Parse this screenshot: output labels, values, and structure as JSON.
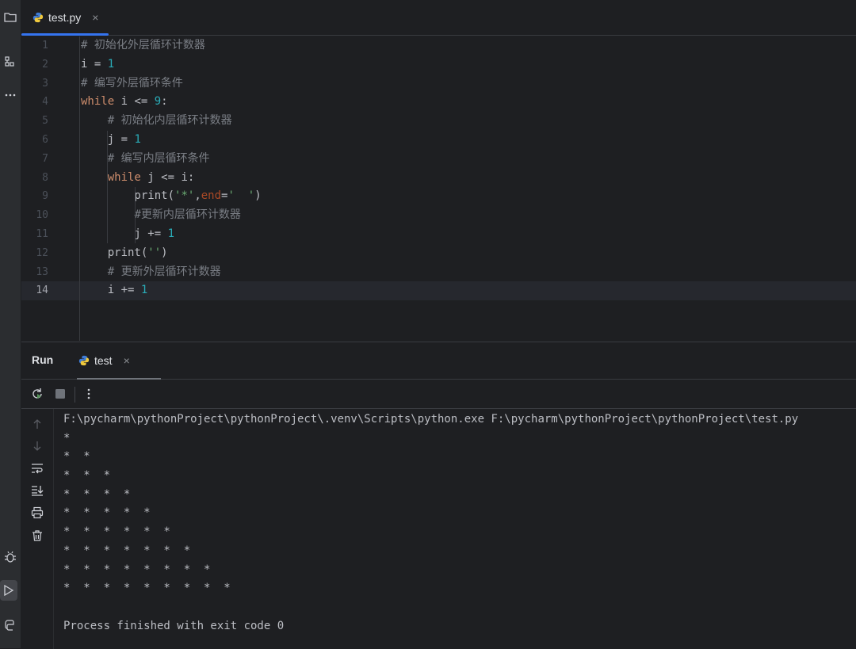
{
  "editor": {
    "tab": {
      "label": "test.py",
      "close": "×",
      "icon": "python-file-icon"
    },
    "current_line": 14,
    "lines": [
      {
        "n": "1",
        "tokens": [
          {
            "c": "cm",
            "t": "# 初始化外层循环计数器"
          }
        ]
      },
      {
        "n": "2",
        "tokens": [
          {
            "c": "",
            "t": "i = "
          },
          {
            "c": "num",
            "t": "1"
          }
        ]
      },
      {
        "n": "3",
        "tokens": [
          {
            "c": "cm",
            "t": "# 编写外层循环条件"
          }
        ]
      },
      {
        "n": "4",
        "tokens": [
          {
            "c": "kw",
            "t": "while"
          },
          {
            "c": "",
            "t": " i <= "
          },
          {
            "c": "num",
            "t": "9"
          },
          {
            "c": "",
            "t": ":"
          }
        ]
      },
      {
        "n": "5",
        "tokens": [
          {
            "c": "",
            "t": "    "
          },
          {
            "c": "cm",
            "t": "# 初始化内层循环计数器"
          }
        ]
      },
      {
        "n": "6",
        "tokens": [
          {
            "c": "",
            "t": "    j = "
          },
          {
            "c": "num",
            "t": "1"
          }
        ]
      },
      {
        "n": "7",
        "tokens": [
          {
            "c": "",
            "t": "    "
          },
          {
            "c": "cm",
            "t": "# 编写内层循环条件"
          }
        ]
      },
      {
        "n": "8",
        "tokens": [
          {
            "c": "",
            "t": "    "
          },
          {
            "c": "kw",
            "t": "while"
          },
          {
            "c": "",
            "t": " j <= i:"
          }
        ]
      },
      {
        "n": "9",
        "tokens": [
          {
            "c": "",
            "t": "        print("
          },
          {
            "c": "str",
            "t": "'*'"
          },
          {
            "c": "",
            "t": ","
          },
          {
            "c": "kwarg",
            "t": "end"
          },
          {
            "c": "",
            "t": "="
          },
          {
            "c": "str",
            "t": "'  '"
          },
          {
            "c": "",
            "t": ")"
          }
        ]
      },
      {
        "n": "10",
        "tokens": [
          {
            "c": "",
            "t": "        "
          },
          {
            "c": "cm",
            "t": "#更新内层循环计数器"
          }
        ]
      },
      {
        "n": "11",
        "tokens": [
          {
            "c": "",
            "t": "        j += "
          },
          {
            "c": "num",
            "t": "1"
          }
        ]
      },
      {
        "n": "12",
        "tokens": [
          {
            "c": "",
            "t": "    print("
          },
          {
            "c": "str",
            "t": "''"
          },
          {
            "c": "",
            "t": ")"
          }
        ]
      },
      {
        "n": "13",
        "tokens": [
          {
            "c": "",
            "t": "    "
          },
          {
            "c": "cm",
            "t": "# 更新外层循环计数器"
          }
        ]
      },
      {
        "n": "14",
        "tokens": [
          {
            "c": "",
            "t": "    i += "
          },
          {
            "c": "num",
            "t": "1"
          }
        ]
      }
    ]
  },
  "run_panel": {
    "title": "Run",
    "tab": {
      "label": "test",
      "close": "×",
      "icon": "python-file-icon"
    },
    "toolbar": [
      "rerun-icon",
      "stop-icon",
      "more-options-icon"
    ],
    "side_tools": [
      "scroll-up-icon",
      "scroll-down-icon",
      "soft-wrap-icon",
      "scroll-to-end-icon",
      "print-icon",
      "trash-icon"
    ],
    "console_lines": [
      "F:\\pycharm\\pythonProject\\pythonProject\\.venv\\Scripts\\python.exe F:\\pycharm\\pythonProject\\pythonProject\\test.py",
      "*",
      "*  *",
      "*  *  *",
      "*  *  *  *",
      "*  *  *  *  *",
      "*  *  *  *  *  *",
      "*  *  *  *  *  *  *",
      "*  *  *  *  *  *  *  *",
      "*  *  *  *  *  *  *  *  *",
      "",
      "Process finished with exit code 0"
    ]
  },
  "left_strip": [
    "project-folder-icon",
    "structure-icon",
    "more-tools-icon",
    "debug-icon",
    "run-icon",
    "python-packages-icon"
  ],
  "colors": {
    "background": "#1e1f22",
    "accent": "#3574f0",
    "keyword": "#cf8e6d",
    "number": "#2aacb8",
    "string": "#6aab73",
    "comment": "#7a7e85"
  }
}
